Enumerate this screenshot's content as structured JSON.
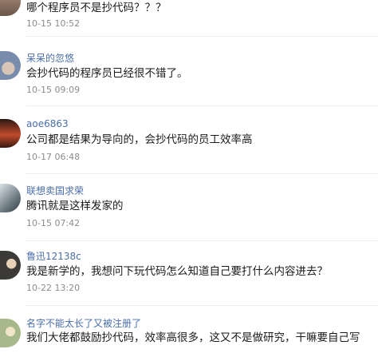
{
  "comments": [
    {
      "username": "",
      "text": "哪个程序员不是抄代码？？？",
      "time": "10-15 10:52",
      "avatar_color": "#8a6f5e"
    },
    {
      "username": "呆呆的忽悠",
      "text": "会抄代码的程序员已经很不错了。",
      "time": "10-15 09:09",
      "avatar_color": "#7a8cab"
    },
    {
      "username": "aoe6863",
      "text": "公司都是结果为导向的，会抄代码的员工效率高",
      "time": "10-17 06:48",
      "avatar_color": "#c14a2c"
    },
    {
      "username": "联想卖国求荣",
      "text": "腾讯就是这样发家的",
      "time": "10-15 07:42",
      "avatar_color": "#6e7a82"
    },
    {
      "username": "鲁迅12138c",
      "text": "我是新学的，我想问下玩代码怎么知道自己要打什么内容进去？",
      "time": "10-22 13:20",
      "avatar_color": "#3b3a36"
    },
    {
      "username": "名字不能太长了又被注册了",
      "text": "我们大佬都鼓励抄代码，效率高很多，这又不是做研究，干嘛要自己写",
      "time": "",
      "avatar_color": "#a7b98a"
    }
  ]
}
